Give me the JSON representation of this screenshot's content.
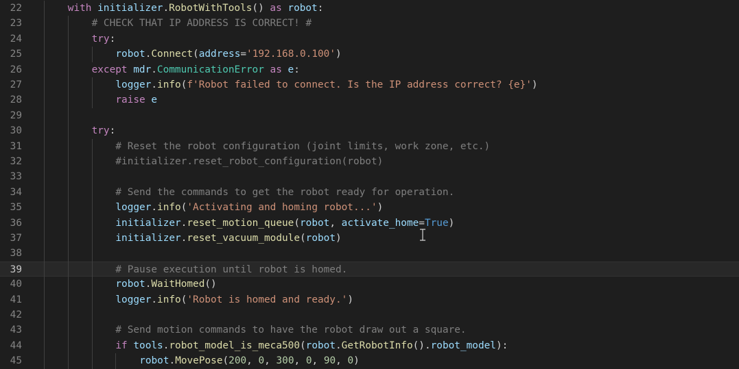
{
  "editor": {
    "lines": [
      {
        "num": "22",
        "indent": 1,
        "tokens": [
          [
            "kw",
            "with"
          ],
          [
            "op",
            " "
          ],
          [
            "var",
            "initializer"
          ],
          [
            "op",
            "."
          ],
          [
            "fn",
            "RobotWithTools"
          ],
          [
            "op",
            "() "
          ],
          [
            "kw",
            "as"
          ],
          [
            "op",
            " "
          ],
          [
            "var",
            "robot"
          ],
          [
            "op",
            ":"
          ]
        ]
      },
      {
        "num": "23",
        "indent": 2,
        "tokens": [
          [
            "com",
            "# CHECK THAT IP ADDRESS IS CORRECT! #"
          ]
        ]
      },
      {
        "num": "24",
        "indent": 2,
        "tokens": [
          [
            "kw",
            "try"
          ],
          [
            "op",
            ":"
          ]
        ]
      },
      {
        "num": "25",
        "indent": 3,
        "tokens": [
          [
            "var",
            "robot"
          ],
          [
            "op",
            "."
          ],
          [
            "fn",
            "Connect"
          ],
          [
            "op",
            "("
          ],
          [
            "var",
            "address"
          ],
          [
            "op",
            "="
          ],
          [
            "str",
            "'192.168.0.100'"
          ],
          [
            "op",
            ")"
          ]
        ]
      },
      {
        "num": "26",
        "indent": 2,
        "tokens": [
          [
            "kw",
            "except"
          ],
          [
            "op",
            " "
          ],
          [
            "var",
            "mdr"
          ],
          [
            "op",
            "."
          ],
          [
            "cls",
            "CommunicationError"
          ],
          [
            "op",
            " "
          ],
          [
            "kw",
            "as"
          ],
          [
            "op",
            " "
          ],
          [
            "var",
            "e"
          ],
          [
            "op",
            ":"
          ]
        ]
      },
      {
        "num": "27",
        "indent": 3,
        "tokens": [
          [
            "var",
            "logger"
          ],
          [
            "op",
            "."
          ],
          [
            "fn",
            "info"
          ],
          [
            "op",
            "("
          ],
          [
            "str",
            "f'Robot failed to connect. Is the IP address correct? {e}'"
          ],
          [
            "op",
            ")"
          ]
        ]
      },
      {
        "num": "28",
        "indent": 3,
        "tokens": [
          [
            "kw",
            "raise"
          ],
          [
            "op",
            " "
          ],
          [
            "var",
            "e"
          ]
        ]
      },
      {
        "num": "29",
        "indent": 0,
        "guides": 2,
        "tokens": []
      },
      {
        "num": "30",
        "indent": 2,
        "tokens": [
          [
            "kw",
            "try"
          ],
          [
            "op",
            ":"
          ]
        ]
      },
      {
        "num": "31",
        "indent": 3,
        "tokens": [
          [
            "com",
            "# Reset the robot configuration (joint limits, work zone, etc.)"
          ]
        ]
      },
      {
        "num": "32",
        "indent": 3,
        "tokens": [
          [
            "com",
            "#initializer.reset_robot_configuration(robot)"
          ]
        ]
      },
      {
        "num": "33",
        "indent": 0,
        "guides": 3,
        "tokens": []
      },
      {
        "num": "34",
        "indent": 3,
        "tokens": [
          [
            "com",
            "# Send the commands to get the robot ready for operation."
          ]
        ]
      },
      {
        "num": "35",
        "indent": 3,
        "tokens": [
          [
            "var",
            "logger"
          ],
          [
            "op",
            "."
          ],
          [
            "fn",
            "info"
          ],
          [
            "op",
            "("
          ],
          [
            "str",
            "'Activating and homing robot...'"
          ],
          [
            "op",
            ")"
          ]
        ]
      },
      {
        "num": "36",
        "indent": 3,
        "tokens": [
          [
            "var",
            "initializer"
          ],
          [
            "op",
            "."
          ],
          [
            "fn",
            "reset_motion_queue"
          ],
          [
            "op",
            "("
          ],
          [
            "var",
            "robot"
          ],
          [
            "op",
            ", "
          ],
          [
            "var",
            "activate_home"
          ],
          [
            "op",
            "="
          ],
          [
            "bool",
            "True"
          ],
          [
            "op",
            ")"
          ]
        ]
      },
      {
        "num": "37",
        "indent": 3,
        "tokens": [
          [
            "var",
            "initializer"
          ],
          [
            "op",
            "."
          ],
          [
            "fn",
            "reset_vacuum_module"
          ],
          [
            "op",
            "("
          ],
          [
            "var",
            "robot"
          ],
          [
            "op",
            ")"
          ]
        ]
      },
      {
        "num": "38",
        "indent": 0,
        "guides": 3,
        "tokens": []
      },
      {
        "num": "39",
        "indent": 3,
        "current": true,
        "tokens": [
          [
            "com",
            "# Pause execution until robot is homed."
          ]
        ]
      },
      {
        "num": "40",
        "indent": 3,
        "tokens": [
          [
            "var",
            "robot"
          ],
          [
            "op",
            "."
          ],
          [
            "fn",
            "WaitHomed"
          ],
          [
            "op",
            "()"
          ]
        ]
      },
      {
        "num": "41",
        "indent": 3,
        "tokens": [
          [
            "var",
            "logger"
          ],
          [
            "op",
            "."
          ],
          [
            "fn",
            "info"
          ],
          [
            "op",
            "("
          ],
          [
            "str",
            "'Robot is homed and ready.'"
          ],
          [
            "op",
            ")"
          ]
        ]
      },
      {
        "num": "42",
        "indent": 0,
        "guides": 3,
        "tokens": []
      },
      {
        "num": "43",
        "indent": 3,
        "tokens": [
          [
            "com",
            "# Send motion commands to have the robot draw out a square."
          ]
        ]
      },
      {
        "num": "44",
        "indent": 3,
        "tokens": [
          [
            "kw",
            "if"
          ],
          [
            "op",
            " "
          ],
          [
            "var",
            "tools"
          ],
          [
            "op",
            "."
          ],
          [
            "fn",
            "robot_model_is_meca500"
          ],
          [
            "op",
            "("
          ],
          [
            "var",
            "robot"
          ],
          [
            "op",
            "."
          ],
          [
            "fn",
            "GetRobotInfo"
          ],
          [
            "op",
            "()."
          ],
          [
            "var",
            "robot_model"
          ],
          [
            "op",
            "):"
          ]
        ]
      },
      {
        "num": "45",
        "indent": 4,
        "tokens": [
          [
            "var",
            "robot"
          ],
          [
            "op",
            "."
          ],
          [
            "fn",
            "MovePose"
          ],
          [
            "op",
            "("
          ],
          [
            "num",
            "200"
          ],
          [
            "op",
            ", "
          ],
          [
            "num",
            "0"
          ],
          [
            "op",
            ", "
          ],
          [
            "num",
            "300"
          ],
          [
            "op",
            ", "
          ],
          [
            "num",
            "0"
          ],
          [
            "op",
            ", "
          ],
          [
            "num",
            "90"
          ],
          [
            "op",
            ", "
          ],
          [
            "num",
            "0"
          ],
          [
            "op",
            ")"
          ]
        ]
      }
    ]
  },
  "icons": {
    "cursor": "text-cursor-icon"
  }
}
